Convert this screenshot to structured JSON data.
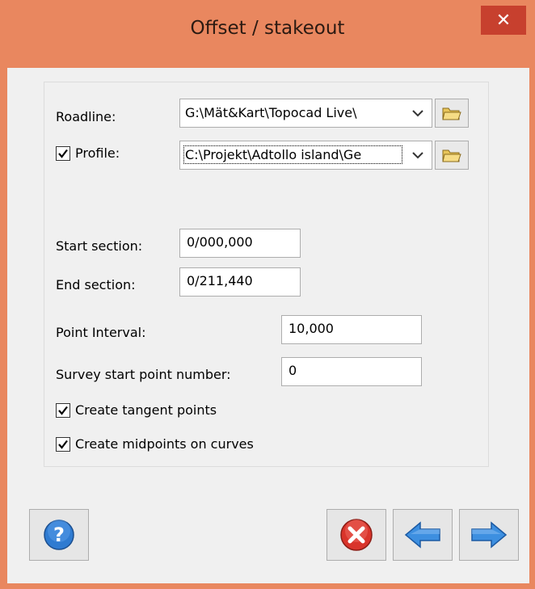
{
  "window": {
    "title": "Offset / stakeout",
    "close_label": "✕"
  },
  "form": {
    "roadline": {
      "label": "Roadline:",
      "value": "G:\\Mät&Kart\\Topocad Live\\"
    },
    "profile": {
      "label": "Profile:",
      "checked": true,
      "value": "C:\\Projekt\\Adtollo island\\Ge"
    },
    "start_section": {
      "label": "Start section:",
      "value": "0/000,000"
    },
    "end_section": {
      "label": "End section:",
      "value": "0/211,440"
    },
    "point_interval": {
      "label": "Point Interval:",
      "value": "10,000"
    },
    "survey_start": {
      "label": "Survey start point number:",
      "value": "0"
    },
    "create_tangent": {
      "label": "Create tangent points",
      "checked": true
    },
    "create_midpoints": {
      "label": "Create midpoints on curves",
      "checked": true
    }
  },
  "icons": {
    "folder": "folder-icon",
    "help": "help-icon",
    "cancel": "cancel-icon",
    "back": "arrow-left-icon",
    "next": "arrow-right-icon"
  },
  "colors": {
    "title_bar": "#e9875f",
    "close_button": "#c7402e",
    "client_bg": "#f0f0f0",
    "arrow_blue": "#3d8fe0",
    "cancel_red": "#d9342b",
    "help_blue": "#2f7bd1"
  }
}
